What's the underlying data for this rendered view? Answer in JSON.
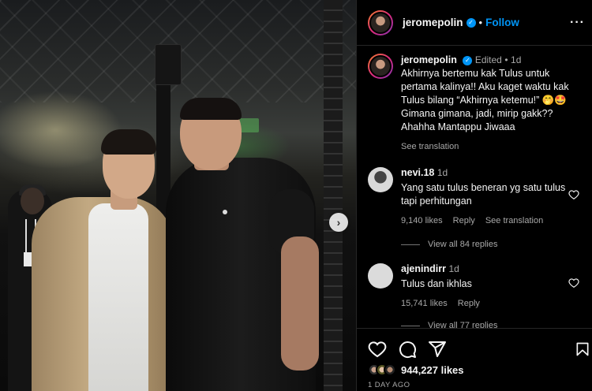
{
  "post": {
    "username": "jeromepolin",
    "follow_label": "Follow",
    "separator": "•",
    "caption": {
      "edited_label": "Edited",
      "time": "1d",
      "text": "Akhirnya bertemu kak Tulus untuk pertama kalinya!! Aku kaget waktu kak Tulus bilang “Akhirnya ketemu!” 🤭🤩 Gimana gimana, jadi, mirip gakk?? Ahahha Mantappu Jiwaaa",
      "see_translation": "See translation"
    }
  },
  "comments": [
    {
      "username": "nevi.18",
      "time": "1d",
      "text": "Yang satu tulus beneran yg satu tulus tapi perhitungan",
      "likes": "9,140 likes",
      "reply": "Reply",
      "see_translation": "See translation",
      "view_replies": "View all 84 replies"
    },
    {
      "username": "ajenindirr",
      "time": "1d",
      "text": "Tulus dan ikhlas",
      "likes": "15,741 likes",
      "reply": "Reply",
      "view_replies": "View all 77 replies"
    }
  ],
  "footer": {
    "likes": "944,227 likes",
    "time_ago": "1 DAY AGO"
  },
  "icons": {
    "verified": "verified-badge-icon",
    "more": "more-options-icon",
    "like": "heart-icon",
    "comment": "comment-icon",
    "share": "share-icon",
    "save": "bookmark-icon",
    "next": "chevron-right-icon"
  },
  "colors": {
    "link_blue": "#0095f6",
    "muted": "#a8a8a8",
    "background": "#000000"
  }
}
